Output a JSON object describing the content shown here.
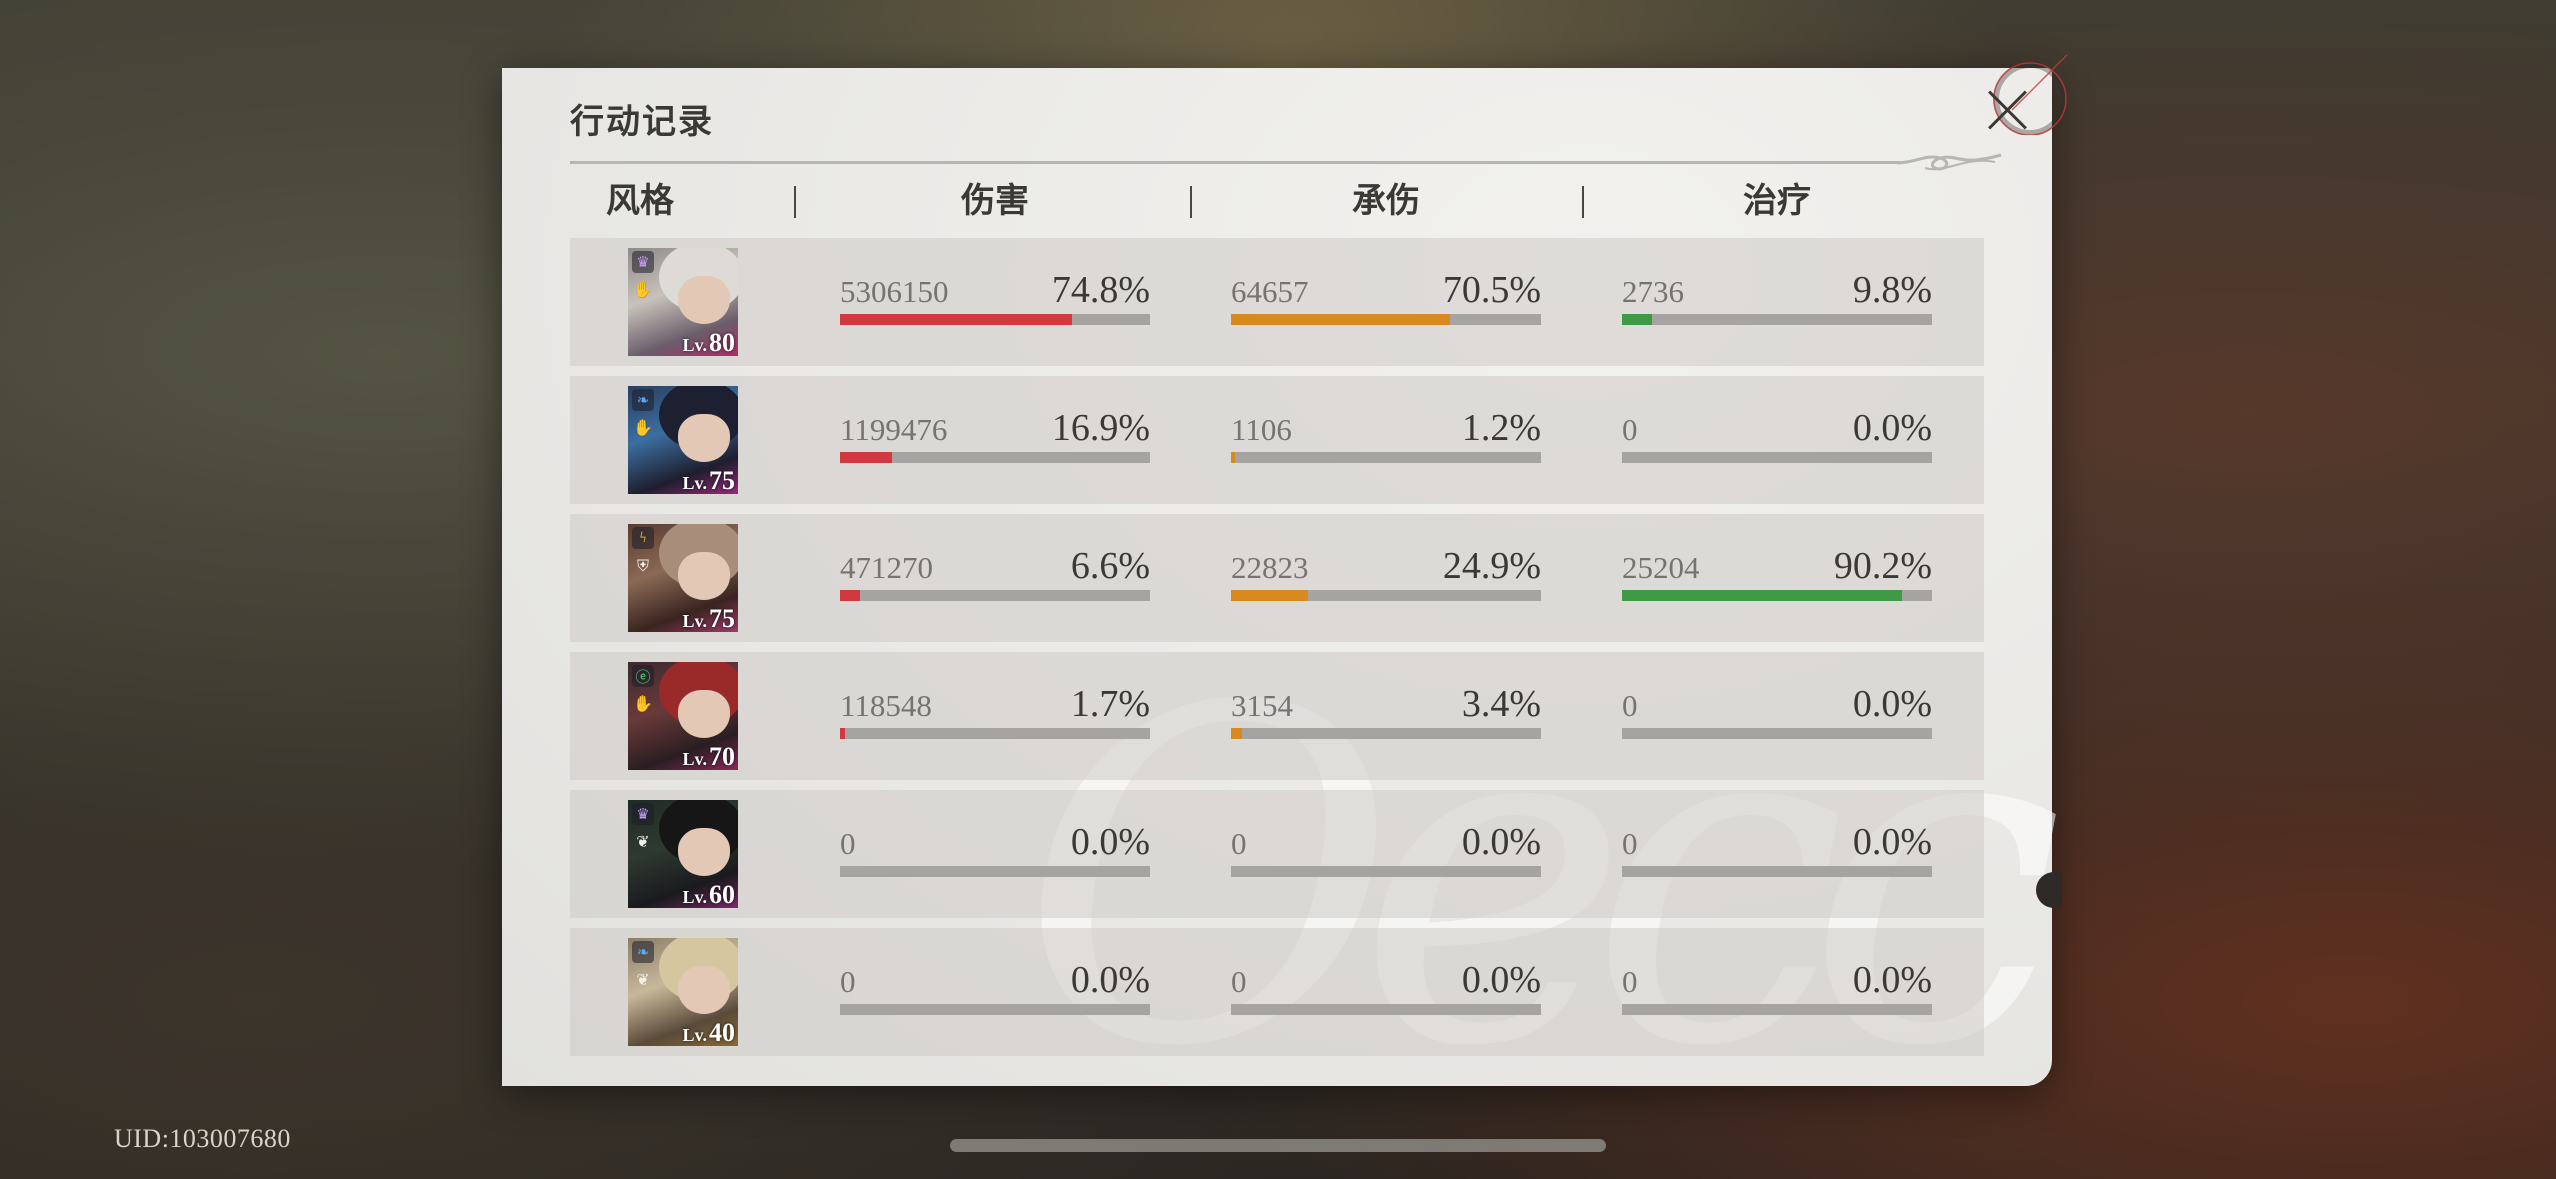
{
  "panel": {
    "title": "行动记录",
    "close_icon": "close-icon"
  },
  "columns": {
    "style": "风格",
    "damage": "伤害",
    "taken": "承伤",
    "heal": "治疗"
  },
  "colors": {
    "damage": "#d0393f",
    "taken": "#d98a1e",
    "heal": "#3e9a45"
  },
  "rows": [
    {
      "level_prefix": "Lv.",
      "level": "80",
      "attribute_icon": "crown-icon",
      "role_icon": "hand-icon",
      "damage": {
        "value": "5306150",
        "percent": "74.8%",
        "fraction": 0.748
      },
      "taken": {
        "value": "64657",
        "percent": "70.5%",
        "fraction": 0.705
      },
      "heal": {
        "value": "2736",
        "percent": "9.8%",
        "fraction": 0.098
      }
    },
    {
      "level_prefix": "Lv.",
      "level": "75",
      "attribute_icon": "feather-icon",
      "role_icon": "hand-icon",
      "damage": {
        "value": "1199476",
        "percent": "16.9%",
        "fraction": 0.169
      },
      "taken": {
        "value": "1106",
        "percent": "1.2%",
        "fraction": 0.012
      },
      "heal": {
        "value": "0",
        "percent": "0.0%",
        "fraction": 0.0
      }
    },
    {
      "level_prefix": "Lv.",
      "level": "75",
      "attribute_icon": "lightning-icon",
      "role_icon": "shield-icon",
      "damage": {
        "value": "471270",
        "percent": "6.6%",
        "fraction": 0.066
      },
      "taken": {
        "value": "22823",
        "percent": "24.9%",
        "fraction": 0.249
      },
      "heal": {
        "value": "25204",
        "percent": "90.2%",
        "fraction": 0.902
      }
    },
    {
      "level_prefix": "Lv.",
      "level": "70",
      "attribute_icon": "leaf-icon",
      "role_icon": "hand-icon",
      "damage": {
        "value": "118548",
        "percent": "1.7%",
        "fraction": 0.017
      },
      "taken": {
        "value": "3154",
        "percent": "3.4%",
        "fraction": 0.034
      },
      "heal": {
        "value": "0",
        "percent": "0.0%",
        "fraction": 0.0
      }
    },
    {
      "level_prefix": "Lv.",
      "level": "60",
      "attribute_icon": "crown-icon",
      "role_icon": "wings-icon",
      "damage": {
        "value": "0",
        "percent": "0.0%",
        "fraction": 0.0
      },
      "taken": {
        "value": "0",
        "percent": "0.0%",
        "fraction": 0.0
      },
      "heal": {
        "value": "0",
        "percent": "0.0%",
        "fraction": 0.0
      }
    },
    {
      "level_prefix": "Lv.",
      "level": "40",
      "attribute_icon": "feather-icon",
      "role_icon": "wings-icon",
      "damage": {
        "value": "0",
        "percent": "0.0%",
        "fraction": 0.0
      },
      "taken": {
        "value": "0",
        "percent": "0.0%",
        "fraction": 0.0
      },
      "heal": {
        "value": "0",
        "percent": "0.0%",
        "fraction": 0.0
      }
    }
  ],
  "footer": {
    "uid": "UID:103007680"
  }
}
